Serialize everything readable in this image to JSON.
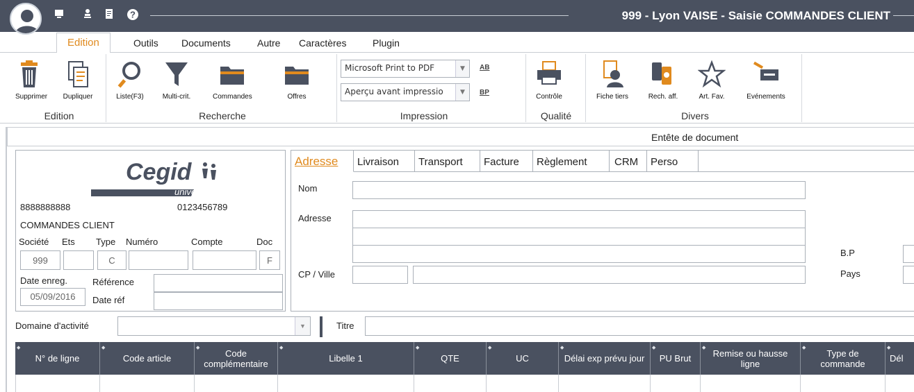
{
  "titlebar": {
    "title": "999 - Lyon VAISE - Saisie COMMANDES CLIENT",
    "quick_icons": [
      "monitor-icon",
      "user-tree-icon",
      "document-scan-icon",
      "help-icon"
    ],
    "help_glyph": "?"
  },
  "menu": {
    "tabs": [
      "Edition",
      "Outils",
      "Documents",
      "Autre",
      "Caractères",
      "Plugin"
    ],
    "active_index": 0
  },
  "ribbon": {
    "groups": {
      "edition": "Edition",
      "recherche": "Recherche",
      "impression": "Impression",
      "qualite": "Qualité",
      "divers": "Divers"
    },
    "buttons": {
      "supprimer": "Supprimer",
      "dupliquer": "Dupliquer",
      "liste": "Liste(F3)",
      "multicrit": "Multi-crit.",
      "commandes": "Commandes",
      "offres": "Offres",
      "controle": "Contrôle",
      "fiche_tiers": "Fiche tiers",
      "rech_aff": "Rech. aff.",
      "art_fav": "Art. Fav.",
      "evenements": "Evénements"
    },
    "printer_select": "Microsoft Print to PDF",
    "preview_select": "Aperçu avant impressio",
    "small_icon_1": "AB",
    "small_icon_2": "BP"
  },
  "header_band": "Entête de document",
  "info": {
    "logo_word": "Cegid",
    "logo_sub": "universités",
    "phone1": "8888888888",
    "phone2": "0123456789",
    "doc_label": "COMMANDES CLIENT",
    "col_societe": "Société",
    "col_ets": "Ets",
    "col_type": "Type",
    "col_numero": "Numéro",
    "col_compte": "Compte",
    "col_doc": "Doc",
    "val_societe": "999",
    "val_type": "C",
    "val_doc": "F",
    "date_enreg_label": "Date enreg.",
    "date_enreg_value": "05/09/2016",
    "reference_label": "Référence",
    "date_ref_label": "Date réf"
  },
  "tabs": [
    "Adresse",
    "Livraison",
    "Transport",
    "Facture",
    "Règlement",
    "CRM",
    "Perso"
  ],
  "adresse": {
    "nom": "Nom",
    "adresse": "Adresse",
    "cp_ville": "CP / Ville",
    "bp": "B.P",
    "pays": "Pays"
  },
  "domaine": {
    "label": "Domaine d'activité",
    "titre": "Titre"
  },
  "grid": {
    "columns": [
      "N° de ligne",
      "Code article",
      "Code complémentaire",
      "Libelle 1",
      "QTE",
      "UC",
      "Délai exp prévu jour",
      "PU Brut",
      "Remise ou hausse ligne",
      "Type de commande",
      "Dél"
    ]
  },
  "colors": {
    "dark": "#4a5160",
    "accent": "#e08a1e",
    "border": "#aab0b8"
  }
}
